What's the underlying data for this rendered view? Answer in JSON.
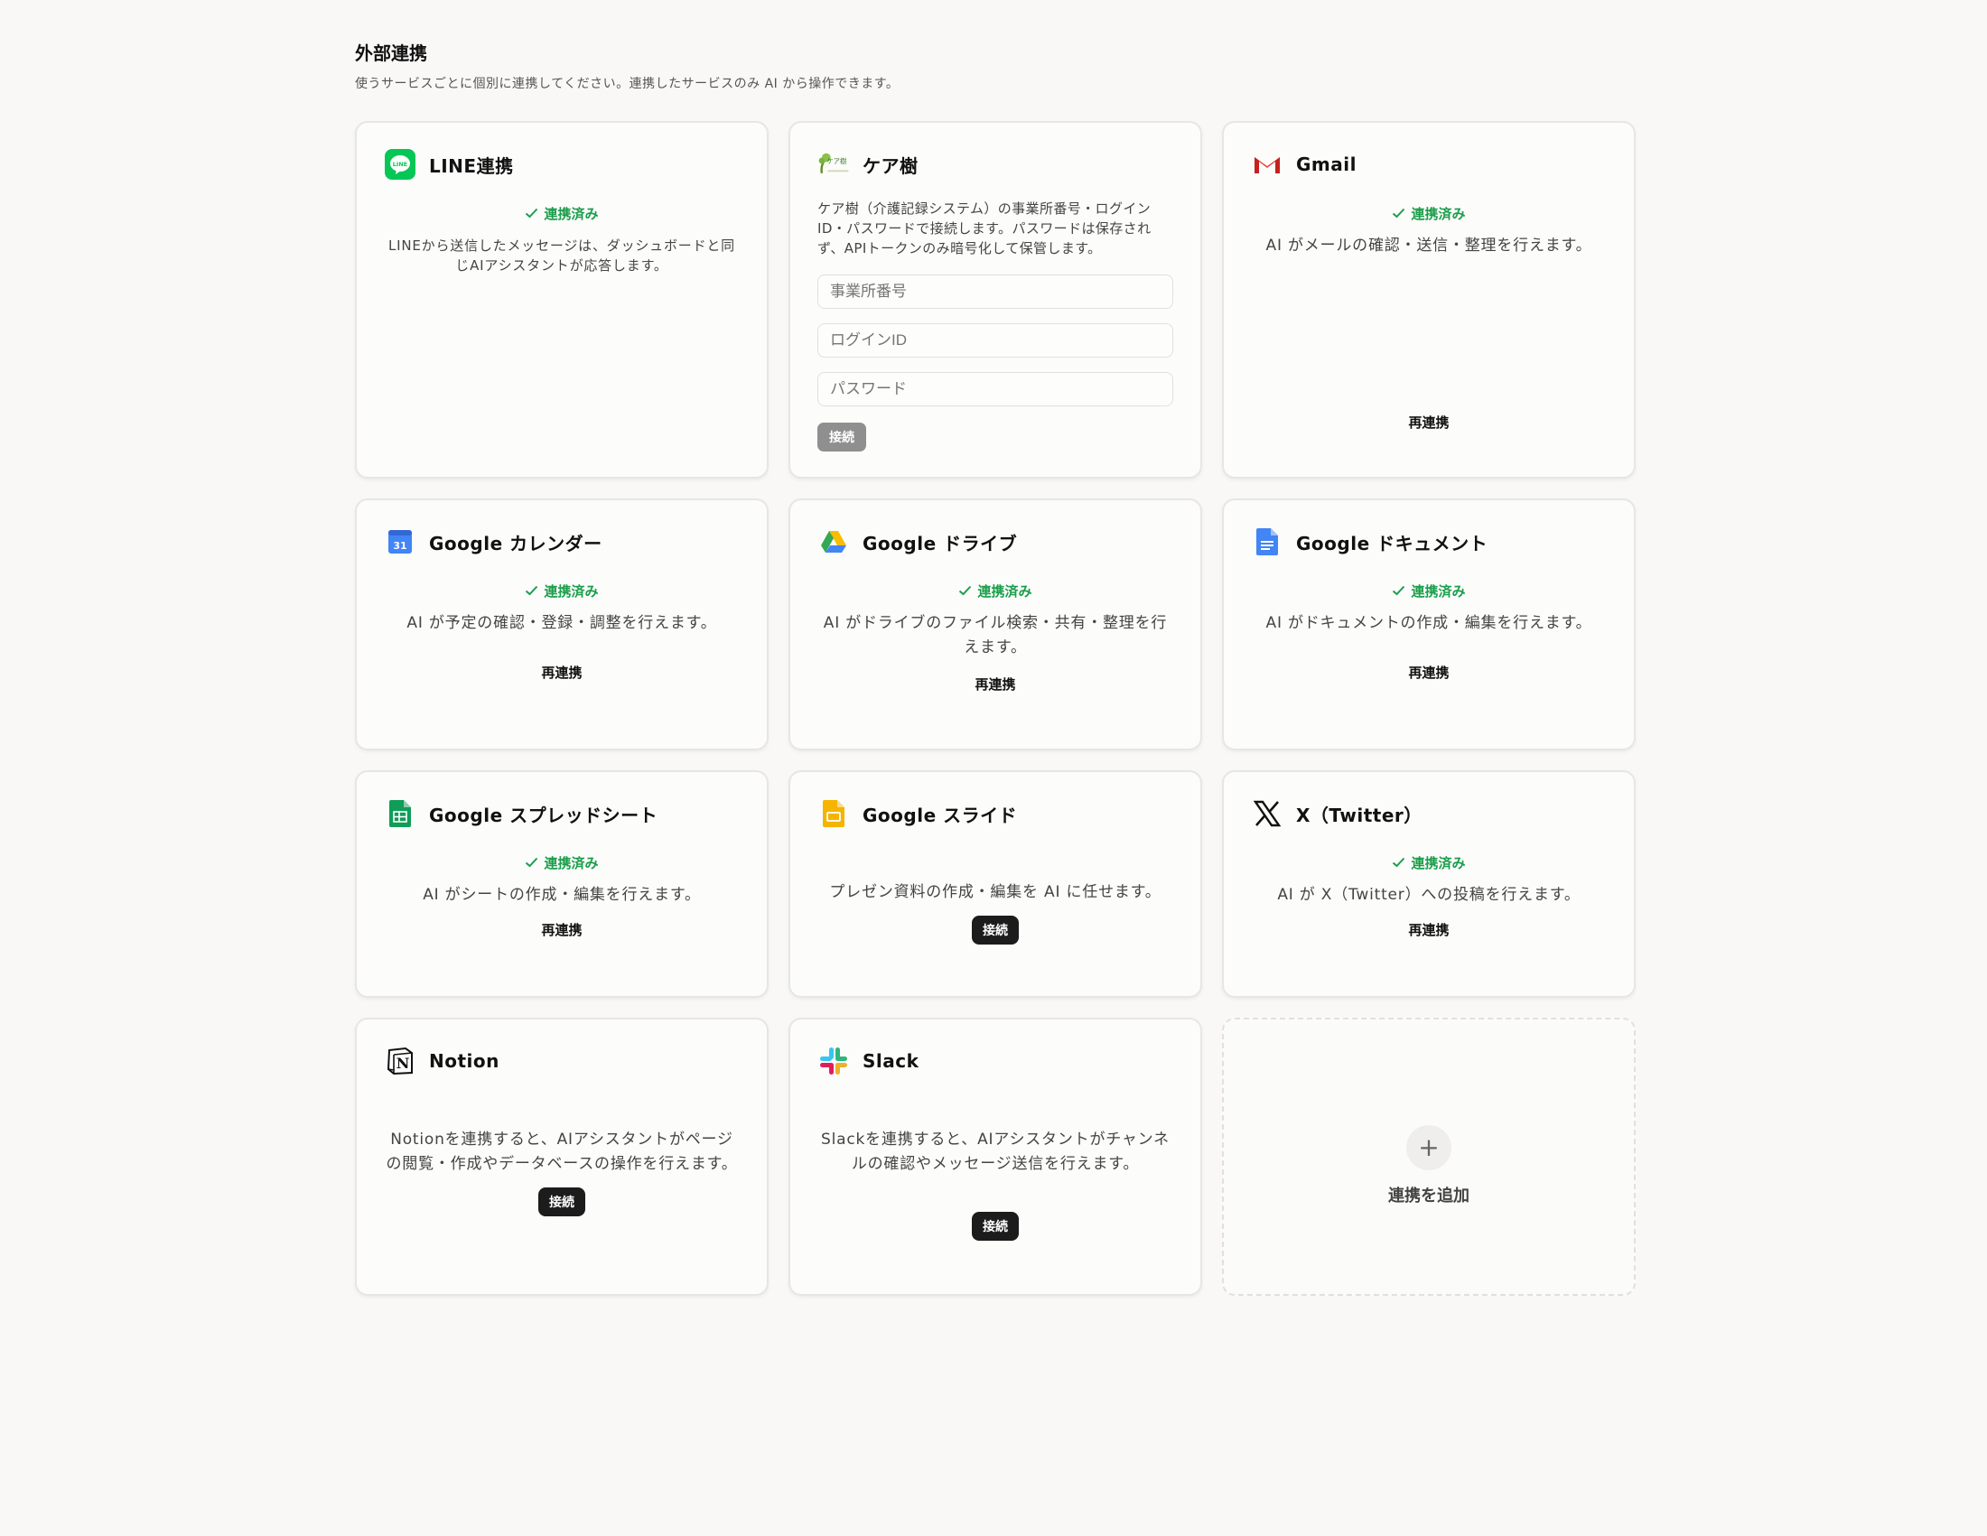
{
  "header": {
    "title": "外部連携",
    "subtitle": "使うサービスごとに個別に連携してください。連携したサービスのみ AI から操作できます。"
  },
  "colors": {
    "connected_green": "#1b9e4b",
    "dark_button": "#1c1c1c",
    "disabled_button": "#8f8f8f"
  },
  "cards": {
    "line": {
      "title": "LINE連携",
      "icon": "line-icon",
      "status": "連携済み",
      "description": "LINEから送信したメッセージは、ダッシュボードと同じAIアシスタントが応答します。"
    },
    "careju": {
      "title": "ケア樹",
      "icon": "careju-logo",
      "description": "ケア樹（介護記録システム）の事業所番号・ログインID・パスワードで接続します。パスワードは保存されず、APIトークンのみ暗号化して保管します。",
      "fields": {
        "office_number": "事業所番号",
        "login_id": "ログインID",
        "password": "パスワード"
      },
      "button": "接続"
    },
    "gmail": {
      "title": "Gmail",
      "icon": "gmail-icon",
      "status": "連携済み",
      "description": "AI がメールの確認・送信・整理を行えます。",
      "button": "再連携"
    },
    "gcal": {
      "title": "Google カレンダー",
      "icon": "google-calendar-icon",
      "icon_text": "31",
      "status": "連携済み",
      "description": "AI が予定の確認・登録・調整を行えます。",
      "button": "再連携"
    },
    "gdrive": {
      "title": "Google ドライブ",
      "icon": "google-drive-icon",
      "status": "連携済み",
      "description": "AI がドライブのファイル検索・共有・整理を行えます。",
      "button": "再連携"
    },
    "gdocs": {
      "title": "Google ドキュメント",
      "icon": "google-docs-icon",
      "status": "連携済み",
      "description": "AI がドキュメントの作成・編集を行えます。",
      "button": "再連携"
    },
    "gsheets": {
      "title": "Google スプレッドシート",
      "icon": "google-sheets-icon",
      "status": "連携済み",
      "description": "AI がシートの作成・編集を行えます。",
      "button": "再連携"
    },
    "gslides": {
      "title": "Google スライド",
      "icon": "google-slides-icon",
      "description": "プレゼン資料の作成・編集を AI に任せます。",
      "button": "接続"
    },
    "x": {
      "title": "X（Twitter）",
      "icon": "x-logo-icon",
      "status": "連携済み",
      "description": "AI が X（Twitter）への投稿を行えます。",
      "button": "再連携"
    },
    "notion": {
      "title": "Notion",
      "icon": "notion-icon",
      "description": "Notionを連携すると、AIアシスタントがページの閲覧・作成やデータベースの操作を行えます。",
      "button": "接続"
    },
    "slack": {
      "title": "Slack",
      "icon": "slack-icon",
      "description": "Slackを連携すると、AIアシスタントがチャンネルの確認やメッセージ送信を行えます。",
      "button": "接続"
    }
  },
  "add_card": {
    "icon": "plus-icon",
    "label": "連携を追加"
  }
}
